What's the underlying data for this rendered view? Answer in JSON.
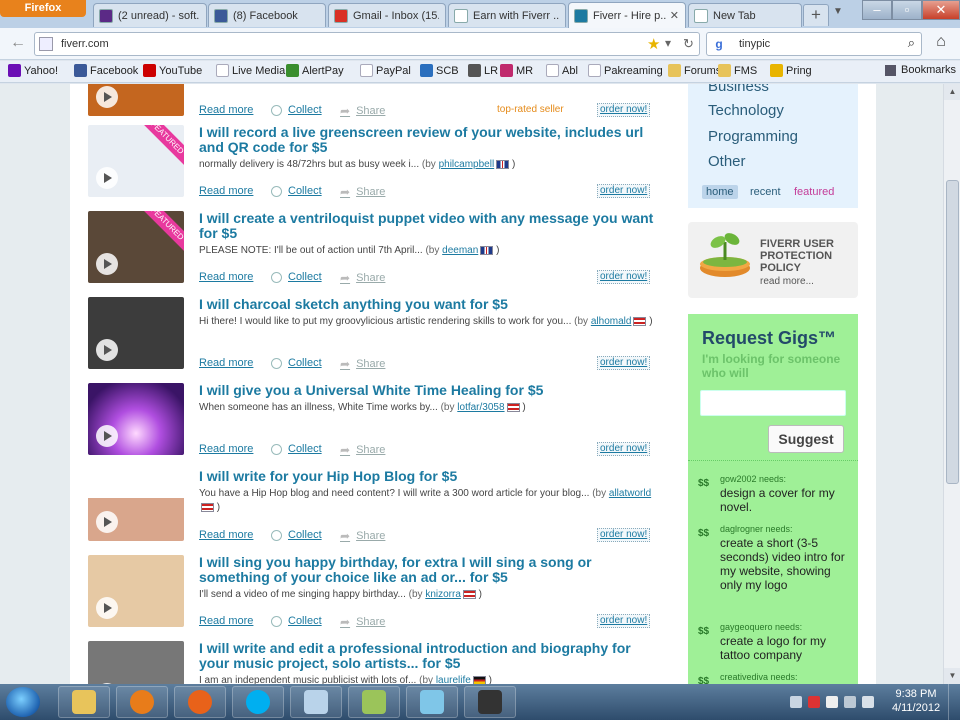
{
  "browser": {
    "menu_button": "Firefox",
    "tabs": [
      {
        "label": "(2 unread) - soft...",
        "icon": "yahoo-mail-icon",
        "color": "#5b2a86"
      },
      {
        "label": "(8) Facebook",
        "icon": "facebook-icon",
        "color": "#3b5998"
      },
      {
        "label": "Gmail - Inbox (15...",
        "icon": "gmail-icon",
        "color": "#d93025"
      },
      {
        "label": "Earn with Fiverr ...",
        "icon": "blank-page-icon",
        "color": "#ffffff"
      },
      {
        "label": "Fiverr - Hire p...",
        "icon": "fiverr-icon",
        "color": "#1c7aa1",
        "active": true
      },
      {
        "label": "New Tab",
        "icon": "blank-page-icon",
        "color": "#ffffff"
      }
    ],
    "new_tab_symbol": "+",
    "url": "fiverr.com",
    "search_engine_glyph": "g",
    "search_text": "tinypic",
    "bookmarks": [
      {
        "label": "Yahoo!",
        "icon": "yahoo-icon",
        "color": "#6b0fb5"
      },
      {
        "label": "Facebook",
        "icon": "facebook-icon",
        "color": "#3b5998"
      },
      {
        "label": "YouTube",
        "icon": "youtube-icon",
        "color": "#cc0000"
      },
      {
        "label": "Live Media",
        "icon": "page-icon",
        "color": "#ffffff"
      },
      {
        "label": "AlertPay",
        "icon": "alertpay-icon",
        "color": "#3a8e2e"
      },
      {
        "label": "PayPal",
        "icon": "page-icon",
        "color": "#ffffff"
      },
      {
        "label": "SCB",
        "icon": "scb-icon",
        "color": "#2b6fbe"
      },
      {
        "label": "LR",
        "icon": "lr-icon",
        "color": "#555555"
      },
      {
        "label": "MR",
        "icon": "mr-icon",
        "color": "#c02a6d"
      },
      {
        "label": "Abl",
        "icon": "page-icon",
        "color": "#ffffff"
      },
      {
        "label": "Pakreaming",
        "icon": "page-icon",
        "color": "#ffffff"
      },
      {
        "label": "Forums",
        "icon": "folder-icon",
        "color": "#e7c35a"
      },
      {
        "label": "FMS",
        "icon": "folder-icon",
        "color": "#e7c35a"
      },
      {
        "label": "Pring",
        "icon": "info-icon",
        "color": "#e8b400"
      }
    ],
    "bookmarks_menu": "Bookmarks"
  },
  "gigs": [
    {
      "title": "",
      "desc": "",
      "by": "",
      "user": "",
      "flag": "",
      "thumb_color": "#c4661f",
      "top_rated": "top-rated seller",
      "actions": true
    },
    {
      "title": "I will record a live greenscreen review of your website, includes url and QR code for $5",
      "desc": "normally delivery is 48/72hrs but as busy week i...",
      "by": "(by",
      "user": "philcampbell",
      "flag": "uk",
      "thumb_color": "#e9eef4",
      "featured": "FEATURED"
    },
    {
      "title": "I will create a ventriloquist puppet video with any message you want for $5",
      "desc": "PLEASE NOTE: I'll be out of action until 7th April...",
      "by": "(by",
      "user": "deeman",
      "flag": "uk",
      "thumb_color": "#5a4838",
      "featured": "FEATURED"
    },
    {
      "title": "I will charcoal sketch anything you want for $5",
      "desc": "Hi there! I would like to put my groovylicious artistic rendering skills to work for you...",
      "by": "(by",
      "user": "alhomald",
      "flag": "us",
      "thumb_color": "#3c3c3c"
    },
    {
      "title": "I will give you a Universal White Time Healing for $5",
      "desc": "When someone has an illness, White Time works by...",
      "by": "(by",
      "user": "lotfar/3058",
      "flag": "us",
      "thumb_color": "#6a2ea1"
    },
    {
      "title": "I will write for your Hip Hop Blog for $5",
      "desc": "You have a Hip Hop blog and need content? I will write a 300 word article for your blog...",
      "by": "(by",
      "user": "allatworld",
      "flag": "us",
      "thumb_color": "#f0f0f0"
    },
    {
      "title": "I will sing you happy birthday, for extra I will sing a song or something of your choice like an ad or... for $5",
      "desc": "I'll send a video of me singing happy birthday...",
      "by": "(by",
      "user": "knizorra",
      "flag": "us",
      "thumb_color": "#e6c9a4"
    },
    {
      "title": "I will write and edit a professional introduction and biography for your music project, solo artists... for $5",
      "desc": "I am an independent music publicist with lots of...",
      "by": "(by",
      "user": "laurelife",
      "flag": "de",
      "thumb_color": "#777777"
    }
  ],
  "actions": {
    "read_more": "Read more",
    "collect": "Collect",
    "share": "Share",
    "order": "order now!"
  },
  "sidebar": {
    "categories": [
      "Business",
      "Technology",
      "Programming",
      "Other"
    ],
    "tabs": [
      "home",
      "recent",
      "featured"
    ],
    "protection_title": "FIVERR USER PROTECTION POLICY",
    "protection_more": "read more...",
    "request_title": "Request Gigs™",
    "request_sub": "I'm looking for someone who will",
    "request_placeholder": "",
    "suggest_button": "Suggest",
    "requests": [
      {
        "name": "gow2002 needs:",
        "text": "design a cover for my novel."
      },
      {
        "name": "daglrogner needs:",
        "text": "create a short (3-5 seconds) video intro for my website, showing only my logo"
      },
      {
        "name": "gaygeoquero needs:",
        "text": "create a logo for my tattoo company"
      },
      {
        "name": "creativediva needs:",
        "text": ""
      }
    ]
  },
  "taskbar": {
    "apps": [
      {
        "name": "explorer",
        "color": "#e8c45b"
      },
      {
        "name": "media-player",
        "color": "#e87c1a"
      },
      {
        "name": "firefox",
        "color": "#e8621a"
      },
      {
        "name": "skype",
        "color": "#00aff0"
      },
      {
        "name": "notepad",
        "color": "#b9d3ea"
      },
      {
        "name": "spreadsheet",
        "color": "#9bc45a"
      },
      {
        "name": "paint",
        "color": "#7fc6e8"
      },
      {
        "name": "recorder",
        "color": "#333333"
      }
    ],
    "time": "9:38 PM",
    "date": "4/11/2012"
  }
}
